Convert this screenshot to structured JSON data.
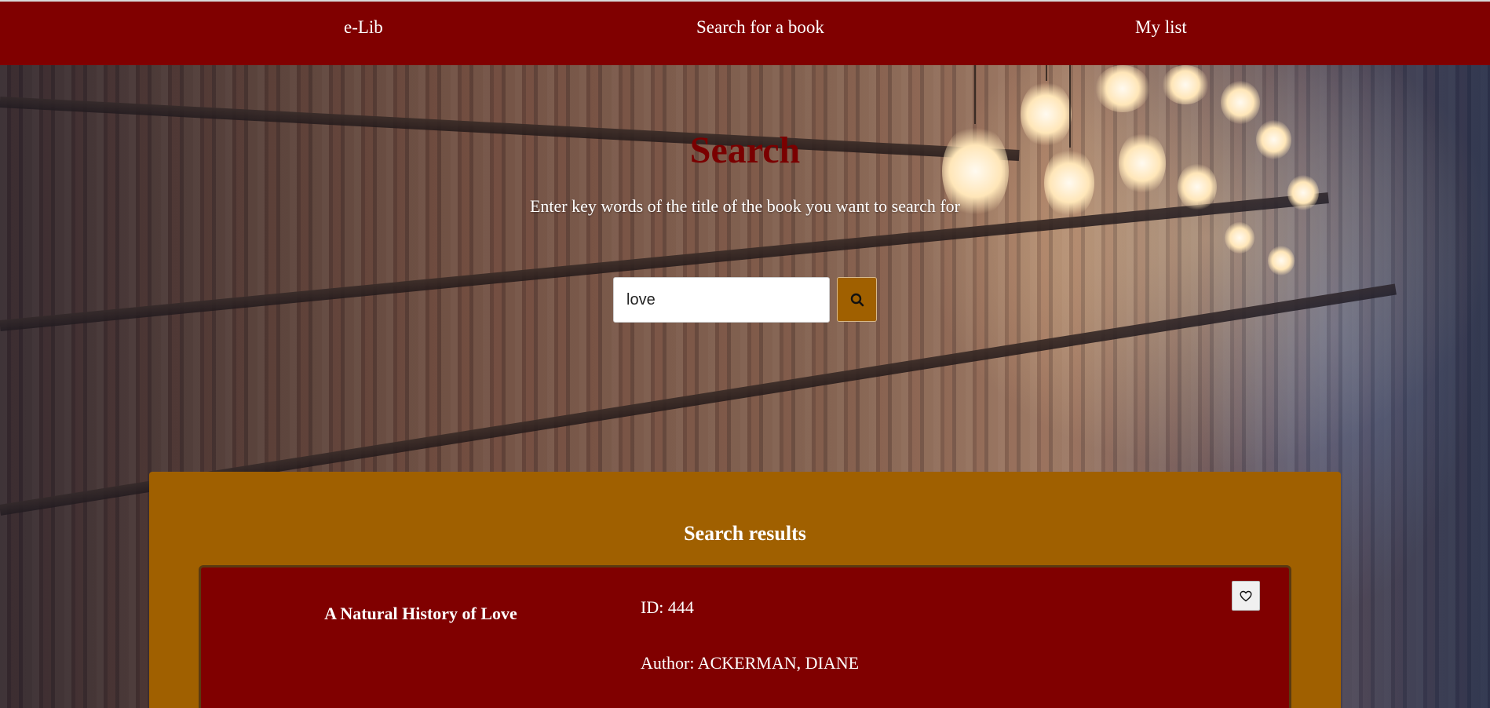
{
  "navbar": {
    "brand": "e-Lib",
    "links": [
      {
        "label": "Search for a book"
      },
      {
        "label": "My list"
      }
    ]
  },
  "search": {
    "title": "Search",
    "subtitle": "Enter key words of the title of the book you want to search for",
    "query": "love",
    "button_icon": "search-icon"
  },
  "results": {
    "heading": "Search results",
    "items": [
      {
        "title": "A Natural History of Love",
        "id_text": "ID: 444",
        "author_text": "Author: ACKERMAN, DIANE",
        "favorite_icon": "heart-outline-icon"
      }
    ]
  },
  "colors": {
    "navbar": "#800000",
    "title": "#7a0000",
    "results_panel": "#a06000",
    "result_card": "#800000",
    "search_button": "#a06000"
  }
}
